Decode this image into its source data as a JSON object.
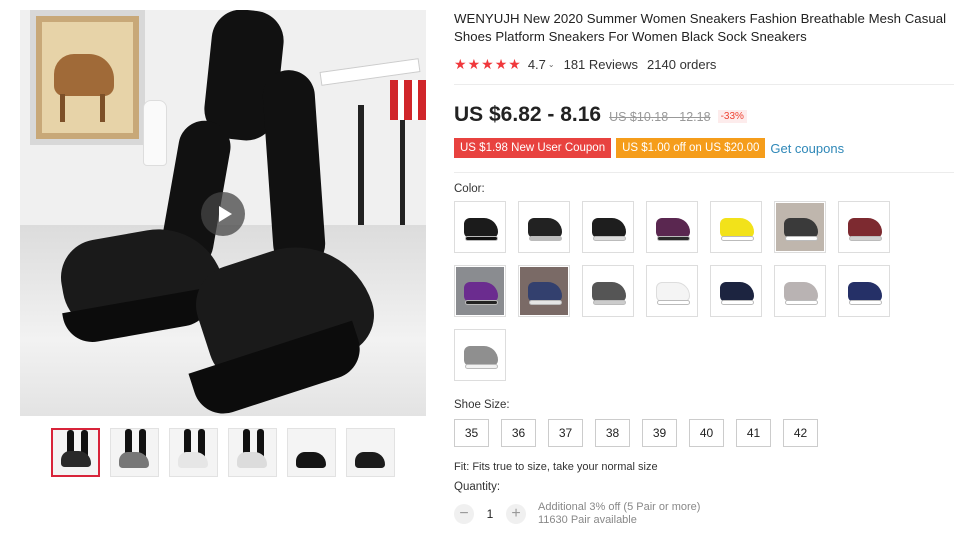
{
  "product": {
    "title": "WENYUJH New 2020 Summer Women Sneakers Fashion Breathable Mesh Casual Shoes Platform Sneakers For Women Black Sock Sneakers",
    "rating": "4.7",
    "reviews": "181 Reviews",
    "orders": "2140 orders",
    "price": "US $6.82 - 8.16",
    "old_price": "US $10.18 - 12.18",
    "discount": "-33%"
  },
  "coupons": {
    "new_user": "US $1.98 New User Coupon",
    "store": "US $1.00 off on US $20.00",
    "get_link": "Get coupons"
  },
  "colors": {
    "label": "Color:",
    "swatches": [
      {
        "name": "black-1",
        "shoe": "#1b1b1b",
        "sole": "#111111",
        "bg": "#ffffff"
      },
      {
        "name": "black-2",
        "shoe": "#222222",
        "sole": "#bcbcbc",
        "bg": "#ffffff"
      },
      {
        "name": "black-3",
        "shoe": "#1e1e1e",
        "sole": "#dcdcdc",
        "bg": "#ffffff"
      },
      {
        "name": "purple",
        "shoe": "#5a2750",
        "sole": "#2a2a2a",
        "bg": "#ffffff"
      },
      {
        "name": "yellow",
        "shoe": "#f2e21a",
        "sole": "#ffffff",
        "bg": "#ffffff"
      },
      {
        "name": "photo-gray",
        "shoe": "#3a3a3a",
        "sole": "#ffffff",
        "bg": "#bfb6ad"
      },
      {
        "name": "wine-red",
        "shoe": "#7d2a30",
        "sole": "#d0d0d0",
        "bg": "#ffffff"
      },
      {
        "name": "photo-purple",
        "shoe": "#6b2c8f",
        "sole": "#222222",
        "bg": "#8a8c90"
      },
      {
        "name": "photo-blue",
        "shoe": "#33406e",
        "sole": "#e5e5e5",
        "bg": "#7a6a66"
      },
      {
        "name": "gray-black",
        "shoe": "#555555",
        "sole": "#cccccc",
        "bg": "#ffffff"
      },
      {
        "name": "white",
        "shoe": "#f4f4f4",
        "sole": "#ffffff",
        "bg": "#ffffff"
      },
      {
        "name": "navy",
        "shoe": "#1c2440",
        "sole": "#ffffff",
        "bg": "#ffffff"
      },
      {
        "name": "light-gray",
        "shoe": "#b9b3b3",
        "sole": "#ffffff",
        "bg": "#ffffff"
      },
      {
        "name": "dark-blue",
        "shoe": "#253067",
        "sole": "#ffffff",
        "bg": "#ffffff"
      },
      {
        "name": "gray",
        "shoe": "#8f8f8f",
        "sole": "#f2f2f2",
        "bg": "#ffffff"
      }
    ]
  },
  "sizes": {
    "label": "Shoe Size:",
    "options": [
      "35",
      "36",
      "37",
      "38",
      "39",
      "40",
      "41",
      "42"
    ]
  },
  "fit": "Fit: Fits true to size, take your normal size",
  "quantity": {
    "label": "Quantity:",
    "value": "1",
    "minus": "−",
    "plus": "+",
    "offer": "Additional 3% off (5 Pair or more)",
    "available": "11630 Pair available"
  },
  "gallery": {
    "icons": {
      "play": "play-icon",
      "star": "star-icon"
    },
    "thumbnails": [
      {
        "name": "thumb-1",
        "tone": "#2a2a2a",
        "active": true
      },
      {
        "name": "thumb-2",
        "tone": "#777777",
        "active": false
      },
      {
        "name": "thumb-3",
        "tone": "#e6e6e6",
        "active": false
      },
      {
        "name": "thumb-4",
        "tone": "#dcdcdc",
        "active": false
      },
      {
        "name": "thumb-5",
        "tone": "#151515",
        "active": false
      },
      {
        "name": "thumb-6",
        "tone": "#1c1c1c",
        "active": false
      }
    ]
  }
}
